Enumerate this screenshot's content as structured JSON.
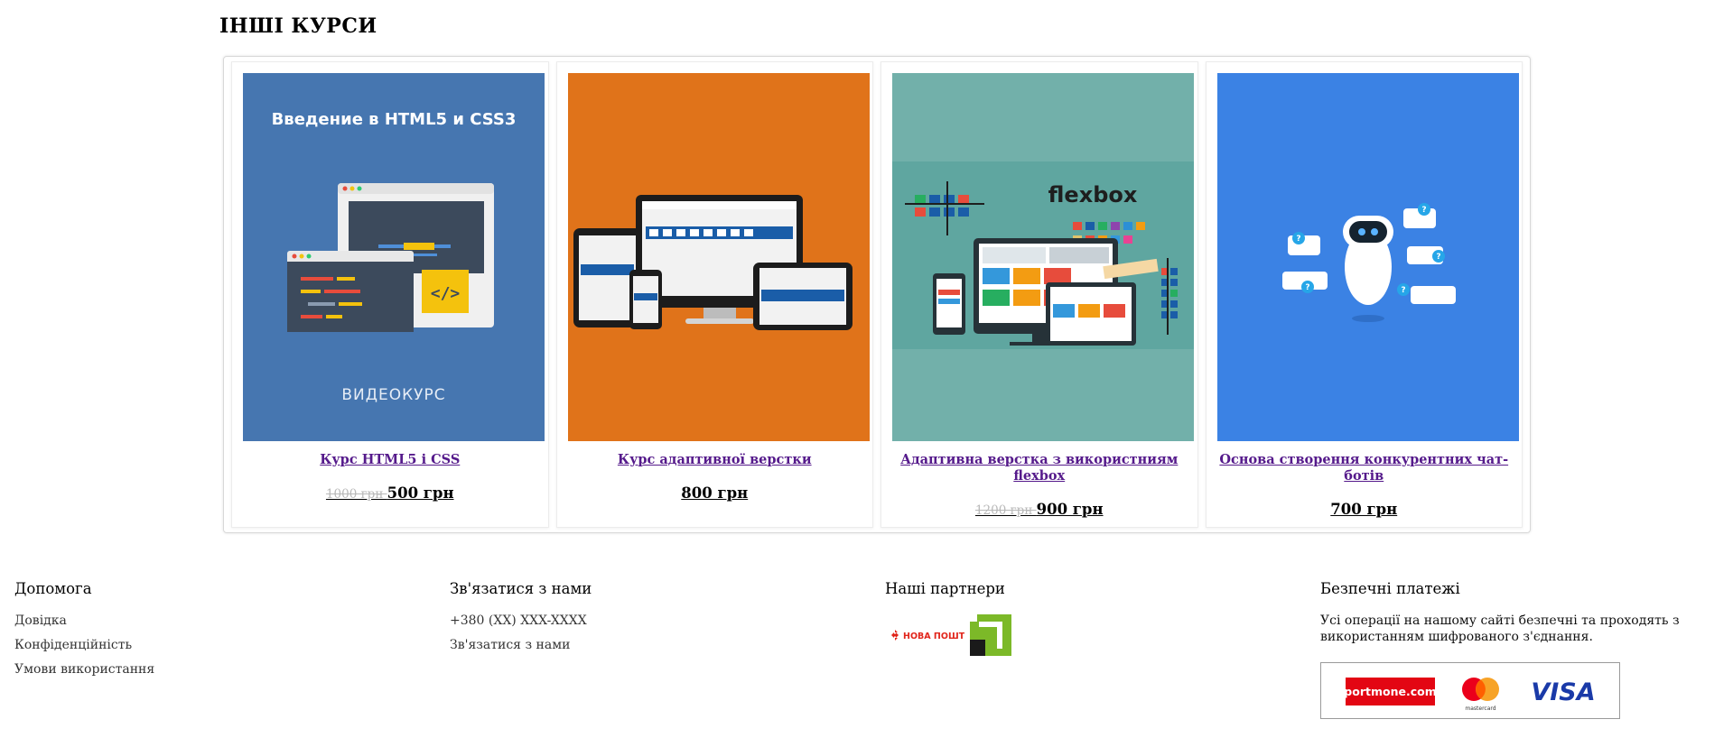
{
  "section": {
    "title": "ІНШІ КУРСИ"
  },
  "courses": [
    {
      "title": "Курс HTML5 і CSS",
      "old_price": "1000 грн",
      "price": "500 грн",
      "cover_heading": "Введение в HTML5 и CSS3",
      "cover_footer": "ВИДЕОКУРС",
      "cover_color": "#4676b0"
    },
    {
      "title": "Курс адаптивної верстки",
      "price": "800 грн",
      "cover_color": "#e0731a"
    },
    {
      "title": "Адаптивна верстка з використниям flexbox",
      "old_price": "1200 грн",
      "price": "900 грн",
      "cover_heading": "flexbox",
      "cover_color": "#72b0aa"
    },
    {
      "title": "Основа створення конкурентних чат-ботів",
      "price": "700 грн",
      "cover_color": "#3b82e4"
    }
  ],
  "footer": {
    "help": {
      "title": "Допомога",
      "links": [
        "Довідка",
        "Конфіденційність",
        "Умови використання"
      ]
    },
    "contact": {
      "title": "Зв'язатися з нами",
      "phone": "+380 (XX) XXX-XXXX",
      "link": "Зв'язатися з нами"
    },
    "partners": {
      "title": "Наші партнери",
      "nova_poshta": "НОВА ПОШТА"
    },
    "payments": {
      "title": "Безпечні платежі",
      "text": "Усі операції на нашому сайті безпечні та проходять з використанням шифрованого з'єднання.",
      "portmone": "portmone.com",
      "mastercard": "mastercard",
      "visa": "VISA"
    }
  }
}
